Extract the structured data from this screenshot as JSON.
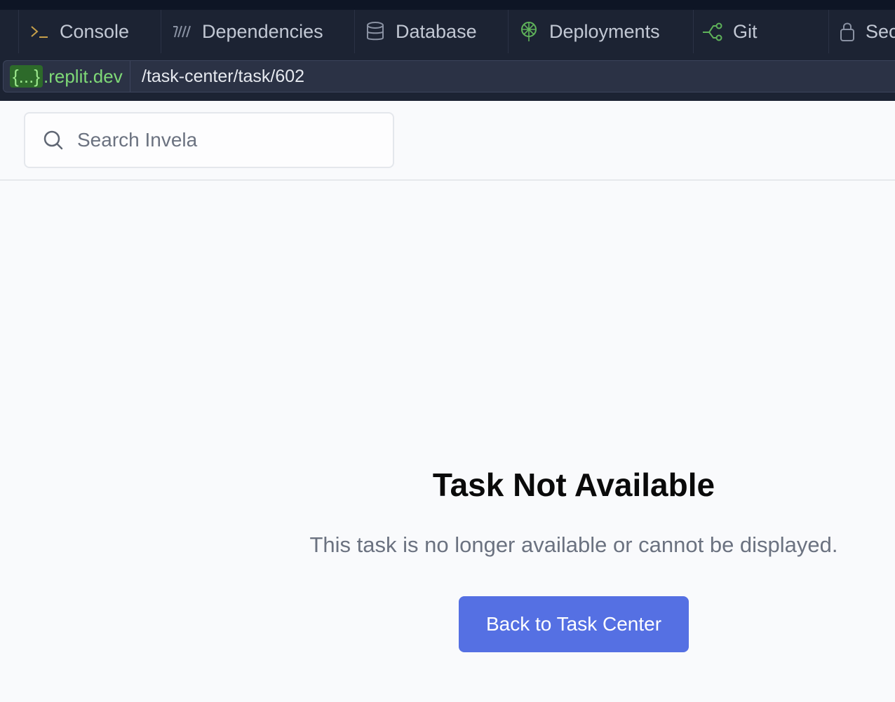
{
  "tabs": [
    {
      "label": "Console",
      "icon": "terminal-icon"
    },
    {
      "label": "Dependencies",
      "icon": "dependencies-icon"
    },
    {
      "label": "Database",
      "icon": "database-icon"
    },
    {
      "label": "Deployments",
      "icon": "deployments-icon"
    },
    {
      "label": "Git",
      "icon": "git-icon"
    },
    {
      "label": "Sec",
      "icon": "lock-icon"
    }
  ],
  "address": {
    "badge": "{...}",
    "domain": ".replit.dev",
    "path": "/task-center/task/602"
  },
  "search": {
    "placeholder": "Search Invela"
  },
  "main": {
    "title": "Task Not Available",
    "message": "This task is no longer available or cannot be displayed.",
    "button_label": "Back to Task Center"
  },
  "colors": {
    "topbar_bg": "#1c2333",
    "accent_button": "#5570e3",
    "domain_green": "#7fd977",
    "page_bg": "#f9fafc"
  }
}
